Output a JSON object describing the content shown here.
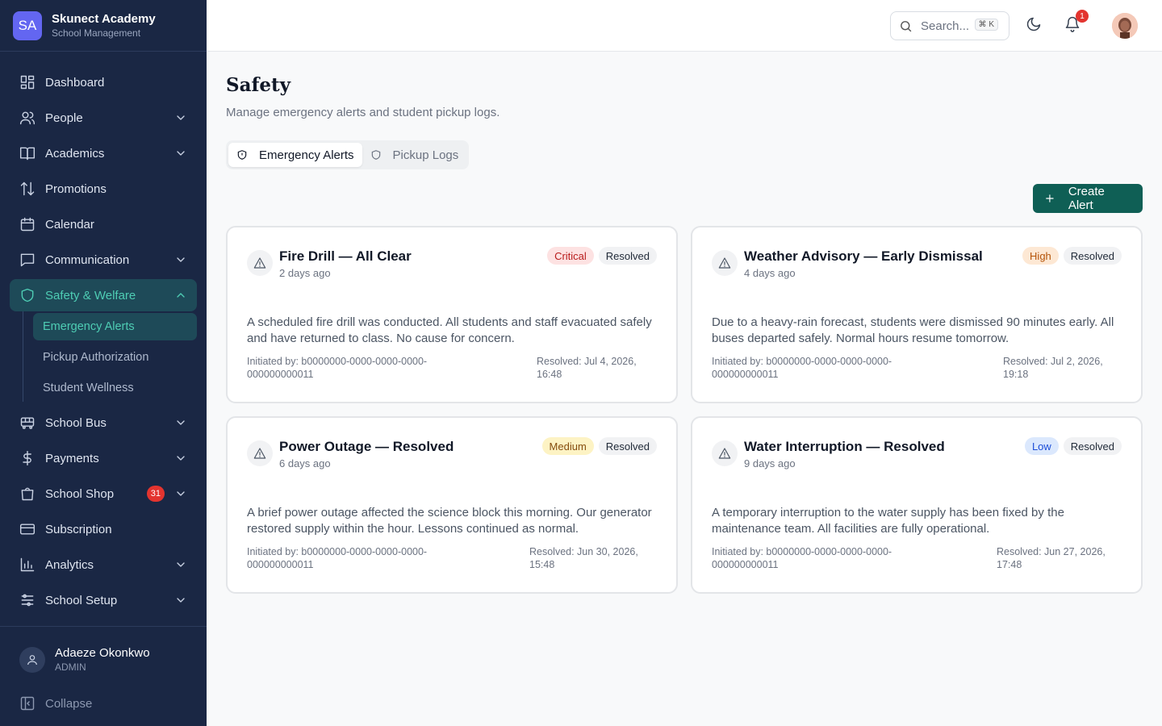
{
  "brand": {
    "initials": "SA",
    "name": "Skunect Academy",
    "subtitle": "School Management"
  },
  "sidebar": {
    "items": [
      {
        "label": "Dashboard",
        "icon": "dashboard-icon"
      },
      {
        "label": "People",
        "icon": "people-icon"
      },
      {
        "label": "Academics",
        "icon": "book-icon"
      },
      {
        "label": "Promotions",
        "icon": "arrows-icon"
      },
      {
        "label": "Calendar",
        "icon": "calendar-icon"
      },
      {
        "label": "Communication",
        "icon": "chat-icon"
      },
      {
        "label": "Safety & Welfare",
        "icon": "shield-icon"
      },
      {
        "label": "School Bus",
        "icon": "bus-icon"
      },
      {
        "label": "Payments",
        "icon": "dollar-icon"
      },
      {
        "label": "School Shop",
        "icon": "shop-icon",
        "badge": "31"
      },
      {
        "label": "Subscription",
        "icon": "card-icon"
      },
      {
        "label": "Analytics",
        "icon": "chart-icon"
      },
      {
        "label": "School Setup",
        "icon": "sliders-icon"
      }
    ],
    "subitems": [
      {
        "label": "Emergency Alerts"
      },
      {
        "label": "Pickup Authorization"
      },
      {
        "label": "Student Wellness"
      }
    ]
  },
  "user": {
    "name": "Adaeze Okonkwo",
    "role": "ADMIN"
  },
  "collapse_label": "Collapse",
  "topbar": {
    "search_placeholder": "Search...",
    "shortcut": "⌘ K",
    "notification_count": "1"
  },
  "page": {
    "title": "Safety",
    "subtitle": "Manage emergency alerts and student pickup logs.",
    "tabs": [
      "Emergency Alerts",
      "Pickup Logs"
    ],
    "create_button": "Create Alert"
  },
  "alerts": [
    {
      "title": "Fire Drill — All Clear",
      "time": "2 days ago",
      "severity": "Critical",
      "status": "Resolved",
      "description": "A scheduled fire drill was conducted. All students and staff evacuated safely and have returned to class. No cause for concern.",
      "initiated": "Initiated by: b0000000-0000-0000-0000-000000000011",
      "resolved": "Resolved: Jul 4, 2026, 16:48"
    },
    {
      "title": "Weather Advisory — Early Dismissal",
      "time": "4 days ago",
      "severity": "High",
      "status": "Resolved",
      "description": "Due to a heavy-rain forecast, students were dismissed 90 minutes early. All buses departed safely. Normal hours resume tomorrow.",
      "initiated": "Initiated by: b0000000-0000-0000-0000-000000000011",
      "resolved": "Resolved: Jul 2, 2026, 19:18"
    },
    {
      "title": "Power Outage — Resolved",
      "time": "6 days ago",
      "severity": "Medium",
      "status": "Resolved",
      "description": "A brief power outage affected the science block this morning. Our generator restored supply within the hour. Lessons continued as normal.",
      "initiated": "Initiated by: b0000000-0000-0000-0000-000000000011",
      "resolved": "Resolved: Jun 30, 2026, 15:48"
    },
    {
      "title": "Water Interruption — Resolved",
      "time": "9 days ago",
      "severity": "Low",
      "status": "Resolved",
      "description": "A temporary interruption to the water supply has been fixed by the maintenance team. All facilities are fully operational.",
      "initiated": "Initiated by: b0000000-0000-0000-0000-000000000011",
      "resolved": "Resolved: Jun 27, 2026, 17:48"
    }
  ],
  "colors": {
    "sidebar_bg": "#1a2744",
    "accent": "#4ecdb4",
    "primary_button": "#0f5f55",
    "critical": "#fde2e2",
    "high": "#fde8d4",
    "medium": "#fdf3c4",
    "low": "#dbe8fd"
  }
}
